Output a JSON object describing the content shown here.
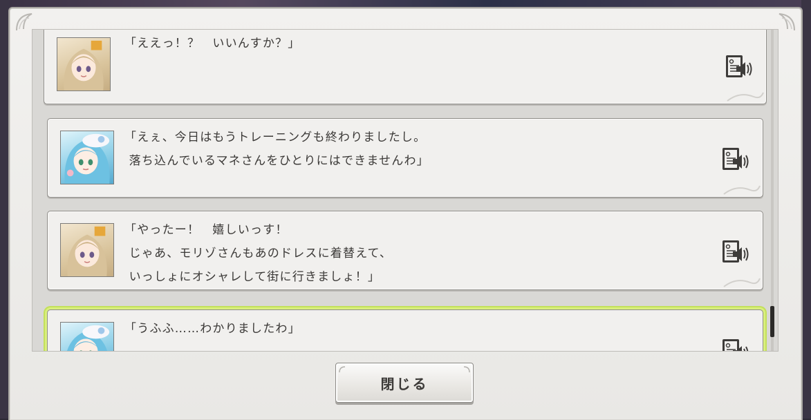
{
  "entries": [
    {
      "character": "blonde-girl",
      "lines": [
        "「ええっ！？　いいんすか？」"
      ]
    },
    {
      "character": "blue-hair-girl",
      "lines": [
        "「えぇ、今日はもうトレーニングも終わりましたし。",
        " 落ち込んでいるマネさんをひとりにはできませんわ」"
      ]
    },
    {
      "character": "blonde-girl",
      "lines": [
        "「やったー！　嬉しいっす！",
        " じゃあ、モリゾさんもあのドレスに着替えて、",
        " いっしょにオシャレして街に行きましょ！」"
      ]
    },
    {
      "character": "blue-hair-girl",
      "lines": [
        "「うふふ……わかりましたわ」"
      ]
    }
  ],
  "close_button": {
    "label": "閉じる"
  },
  "colors": {
    "selected_glow": "#d9ef7d",
    "panel": "#f1f0ee",
    "text": "#3b3937"
  },
  "icons": [
    "voice-replay-icon"
  ]
}
